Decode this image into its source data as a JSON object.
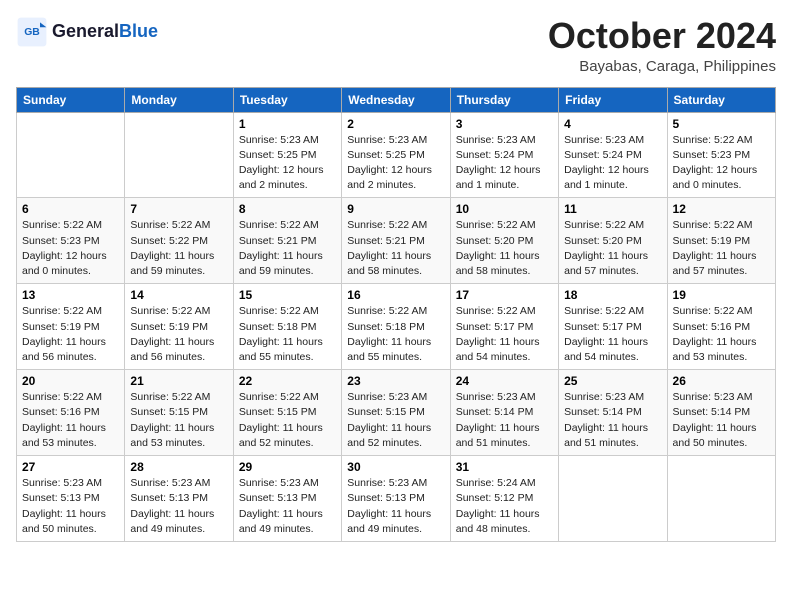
{
  "logo": {
    "general": "General",
    "blue": "Blue"
  },
  "header": {
    "month": "October 2024",
    "location": "Bayabas, Caraga, Philippines"
  },
  "weekdays": [
    "Sunday",
    "Monday",
    "Tuesday",
    "Wednesday",
    "Thursday",
    "Friday",
    "Saturday"
  ],
  "weeks": [
    [
      {
        "day": "",
        "info": ""
      },
      {
        "day": "",
        "info": ""
      },
      {
        "day": "1",
        "info": "Sunrise: 5:23 AM\nSunset: 5:25 PM\nDaylight: 12 hours\nand 2 minutes."
      },
      {
        "day": "2",
        "info": "Sunrise: 5:23 AM\nSunset: 5:25 PM\nDaylight: 12 hours\nand 2 minutes."
      },
      {
        "day": "3",
        "info": "Sunrise: 5:23 AM\nSunset: 5:24 PM\nDaylight: 12 hours\nand 1 minute."
      },
      {
        "day": "4",
        "info": "Sunrise: 5:23 AM\nSunset: 5:24 PM\nDaylight: 12 hours\nand 1 minute."
      },
      {
        "day": "5",
        "info": "Sunrise: 5:22 AM\nSunset: 5:23 PM\nDaylight: 12 hours\nand 0 minutes."
      }
    ],
    [
      {
        "day": "6",
        "info": "Sunrise: 5:22 AM\nSunset: 5:23 PM\nDaylight: 12 hours\nand 0 minutes."
      },
      {
        "day": "7",
        "info": "Sunrise: 5:22 AM\nSunset: 5:22 PM\nDaylight: 11 hours\nand 59 minutes."
      },
      {
        "day": "8",
        "info": "Sunrise: 5:22 AM\nSunset: 5:21 PM\nDaylight: 11 hours\nand 59 minutes."
      },
      {
        "day": "9",
        "info": "Sunrise: 5:22 AM\nSunset: 5:21 PM\nDaylight: 11 hours\nand 58 minutes."
      },
      {
        "day": "10",
        "info": "Sunrise: 5:22 AM\nSunset: 5:20 PM\nDaylight: 11 hours\nand 58 minutes."
      },
      {
        "day": "11",
        "info": "Sunrise: 5:22 AM\nSunset: 5:20 PM\nDaylight: 11 hours\nand 57 minutes."
      },
      {
        "day": "12",
        "info": "Sunrise: 5:22 AM\nSunset: 5:19 PM\nDaylight: 11 hours\nand 57 minutes."
      }
    ],
    [
      {
        "day": "13",
        "info": "Sunrise: 5:22 AM\nSunset: 5:19 PM\nDaylight: 11 hours\nand 56 minutes."
      },
      {
        "day": "14",
        "info": "Sunrise: 5:22 AM\nSunset: 5:19 PM\nDaylight: 11 hours\nand 56 minutes."
      },
      {
        "day": "15",
        "info": "Sunrise: 5:22 AM\nSunset: 5:18 PM\nDaylight: 11 hours\nand 55 minutes."
      },
      {
        "day": "16",
        "info": "Sunrise: 5:22 AM\nSunset: 5:18 PM\nDaylight: 11 hours\nand 55 minutes."
      },
      {
        "day": "17",
        "info": "Sunrise: 5:22 AM\nSunset: 5:17 PM\nDaylight: 11 hours\nand 54 minutes."
      },
      {
        "day": "18",
        "info": "Sunrise: 5:22 AM\nSunset: 5:17 PM\nDaylight: 11 hours\nand 54 minutes."
      },
      {
        "day": "19",
        "info": "Sunrise: 5:22 AM\nSunset: 5:16 PM\nDaylight: 11 hours\nand 53 minutes."
      }
    ],
    [
      {
        "day": "20",
        "info": "Sunrise: 5:22 AM\nSunset: 5:16 PM\nDaylight: 11 hours\nand 53 minutes."
      },
      {
        "day": "21",
        "info": "Sunrise: 5:22 AM\nSunset: 5:15 PM\nDaylight: 11 hours\nand 53 minutes."
      },
      {
        "day": "22",
        "info": "Sunrise: 5:22 AM\nSunset: 5:15 PM\nDaylight: 11 hours\nand 52 minutes."
      },
      {
        "day": "23",
        "info": "Sunrise: 5:23 AM\nSunset: 5:15 PM\nDaylight: 11 hours\nand 52 minutes."
      },
      {
        "day": "24",
        "info": "Sunrise: 5:23 AM\nSunset: 5:14 PM\nDaylight: 11 hours\nand 51 minutes."
      },
      {
        "day": "25",
        "info": "Sunrise: 5:23 AM\nSunset: 5:14 PM\nDaylight: 11 hours\nand 51 minutes."
      },
      {
        "day": "26",
        "info": "Sunrise: 5:23 AM\nSunset: 5:14 PM\nDaylight: 11 hours\nand 50 minutes."
      }
    ],
    [
      {
        "day": "27",
        "info": "Sunrise: 5:23 AM\nSunset: 5:13 PM\nDaylight: 11 hours\nand 50 minutes."
      },
      {
        "day": "28",
        "info": "Sunrise: 5:23 AM\nSunset: 5:13 PM\nDaylight: 11 hours\nand 49 minutes."
      },
      {
        "day": "29",
        "info": "Sunrise: 5:23 AM\nSunset: 5:13 PM\nDaylight: 11 hours\nand 49 minutes."
      },
      {
        "day": "30",
        "info": "Sunrise: 5:23 AM\nSunset: 5:13 PM\nDaylight: 11 hours\nand 49 minutes."
      },
      {
        "day": "31",
        "info": "Sunrise: 5:24 AM\nSunset: 5:12 PM\nDaylight: 11 hours\nand 48 minutes."
      },
      {
        "day": "",
        "info": ""
      },
      {
        "day": "",
        "info": ""
      }
    ]
  ]
}
